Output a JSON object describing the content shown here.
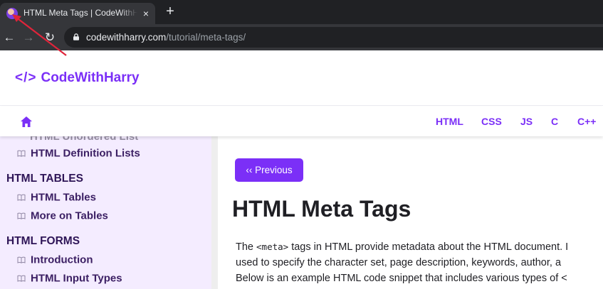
{
  "browser": {
    "tab_title": "HTML Meta Tags | CodeWithHarry",
    "tab_close": "×",
    "new_tab": "+",
    "url_host": "codewithharry.com",
    "url_path": "/tutorial/meta-tags/",
    "back": "←",
    "forward": "→",
    "reload": "↻",
    "tab_favicon_icon": "avatar-favicon",
    "lock_icon": "lock-icon"
  },
  "site": {
    "logo_brackets": "</>",
    "logo_text": "CodeWithHarry",
    "brand_color": "#7b2ff7",
    "nav": [
      "HTML",
      "CSS",
      "JS",
      "C",
      "C++"
    ]
  },
  "sidebar": {
    "cut_item": "HTML Unordered List",
    "items_before": [
      {
        "label": "HTML Definition Lists"
      }
    ],
    "sections": [
      {
        "heading": "HTML TABLES",
        "items": [
          {
            "label": "HTML Tables"
          },
          {
            "label": "More on Tables"
          }
        ]
      },
      {
        "heading": "HTML FORMS",
        "items": [
          {
            "label": "Introduction"
          },
          {
            "label": "HTML Input Types"
          }
        ]
      }
    ]
  },
  "content": {
    "prev_button": "‹‹ Previous",
    "title": "HTML Meta Tags",
    "para_line1_pre": "The ",
    "para_line1_code": "<meta>",
    "para_line1_post": " tags in HTML provide metadata about the HTML document. I",
    "para_line2": "used to specify the character set, page description, keywords, author, a",
    "para_line3": "Below is an example HTML code snippet that includes various types of <"
  }
}
